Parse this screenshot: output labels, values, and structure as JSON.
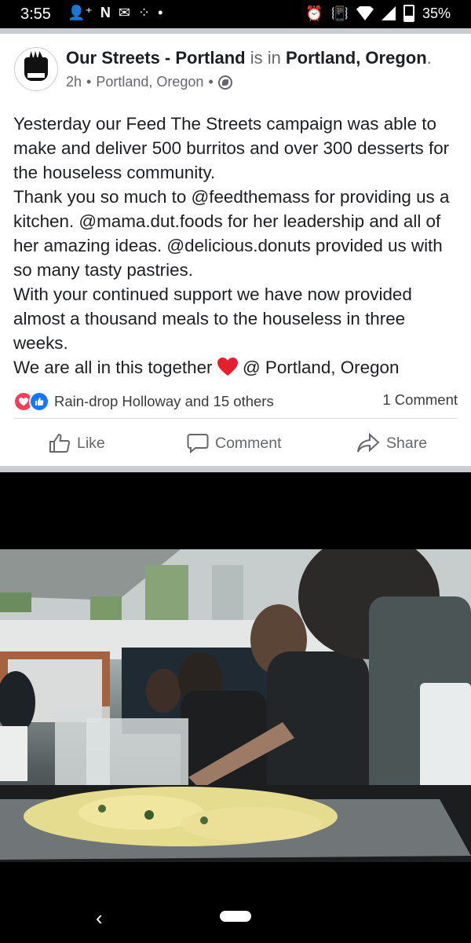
{
  "status_bar": {
    "time": "3:55",
    "battery": "35%"
  },
  "post": {
    "page_name": "Our Streets - Portland",
    "is_in": "is in",
    "location": "Portland, Oregon",
    "period": ".",
    "time_ago": "2h",
    "meta_location": "Portland, Oregon",
    "paragraphs": [
      "Yesterday our Feed The Streets campaign was able to make and deliver 500 burritos and over 300 desserts for the houseless community.",
      "Thank you so much to @feedthemass for providing us a kitchen. @mama.dut.foods for her leadership and all of her amazing ideas. @delicious.donuts provided us with so many tasty pastries.",
      "With your continued support we have now provided almost a thousand meals to the houseless in three weeks."
    ],
    "last_line_before": "We are all in this together",
    "last_line_after": "@ Portland, Oregon",
    "reactions_text": "Rain-drop Holloway and 15 others",
    "comments_text": "1 Comment",
    "actions": {
      "like": "Like",
      "comment": "Comment",
      "share": "Share"
    }
  },
  "colors": {
    "brand_blue": "#1877f2",
    "love_red": "#f33e58",
    "text": "#1c1e21",
    "muted": "#65676b"
  }
}
